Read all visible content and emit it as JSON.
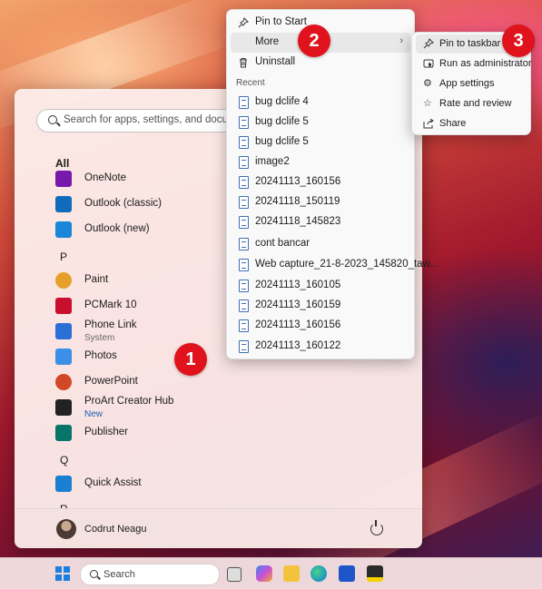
{
  "start_menu": {
    "search_placeholder": "Search for apps, settings, and documents",
    "section_all": "All",
    "apps_o": [
      {
        "name": "OneNote",
        "icon": "onenote-icon",
        "color": "#7719aa"
      },
      {
        "name": "Outlook (classic)",
        "icon": "outlook-classic-icon",
        "color": "#0f6cbd"
      },
      {
        "name": "Outlook (new)",
        "icon": "outlook-new-icon",
        "color": "#1a86d9"
      }
    ],
    "letter_p": "P",
    "apps_p": [
      {
        "name": "Paint",
        "icon": "paint-icon",
        "color": "#e6a02a"
      },
      {
        "name": "PCMark 10",
        "icon": "pcmark-icon",
        "color": "#c8102e"
      },
      {
        "name": "Phone Link",
        "sub": "System",
        "icon": "phone-link-icon",
        "color": "#2a6fd6"
      },
      {
        "name": "Photos",
        "icon": "photos-icon",
        "color": "#3b8fe6"
      },
      {
        "name": "PowerPoint",
        "icon": "powerpoint-icon",
        "color": "#d24726"
      },
      {
        "name": "ProArt Creator Hub",
        "sub": "New",
        "icon": "proart-icon",
        "color": "#222222"
      },
      {
        "name": "Publisher",
        "icon": "publisher-icon",
        "color": "#077568"
      }
    ],
    "letter_q": "Q",
    "apps_q": [
      {
        "name": "Quick Assist",
        "icon": "quick-assist-icon",
        "color": "#1a7fd0"
      }
    ],
    "letter_r": "R",
    "user_name": "Codrut Neagu"
  },
  "context_menu": {
    "pin_to_start": "Pin to Start",
    "more": "More",
    "uninstall": "Uninstall",
    "recent_header": "Recent",
    "recent_files": [
      "bug dclife 4",
      "bug dclife 5",
      "bug dclife 5",
      "image2",
      "20241113_160156",
      "20241118_150119",
      "20241118_145823",
      "cont bancar",
      "Web capture_21-8-2023_145820_taw...",
      "20241113_160105",
      "20241113_160159",
      "20241113_160156",
      "20241113_160122"
    ]
  },
  "more_submenu": {
    "items": [
      {
        "label": "Pin to taskbar",
        "icon": "pin-icon"
      },
      {
        "label": "Run as administrator",
        "icon": "admin-shield-icon"
      },
      {
        "label": "App settings",
        "icon": "gear-icon"
      },
      {
        "label": "Rate and review",
        "icon": "rate-review-icon"
      },
      {
        "label": "Share",
        "icon": "share-icon"
      }
    ]
  },
  "badges": [
    "1",
    "2",
    "3"
  ],
  "taskbar": {
    "search_placeholder": "Search"
  },
  "colors": {
    "badge": "#e0121b",
    "accent": "#1a7fe0"
  }
}
